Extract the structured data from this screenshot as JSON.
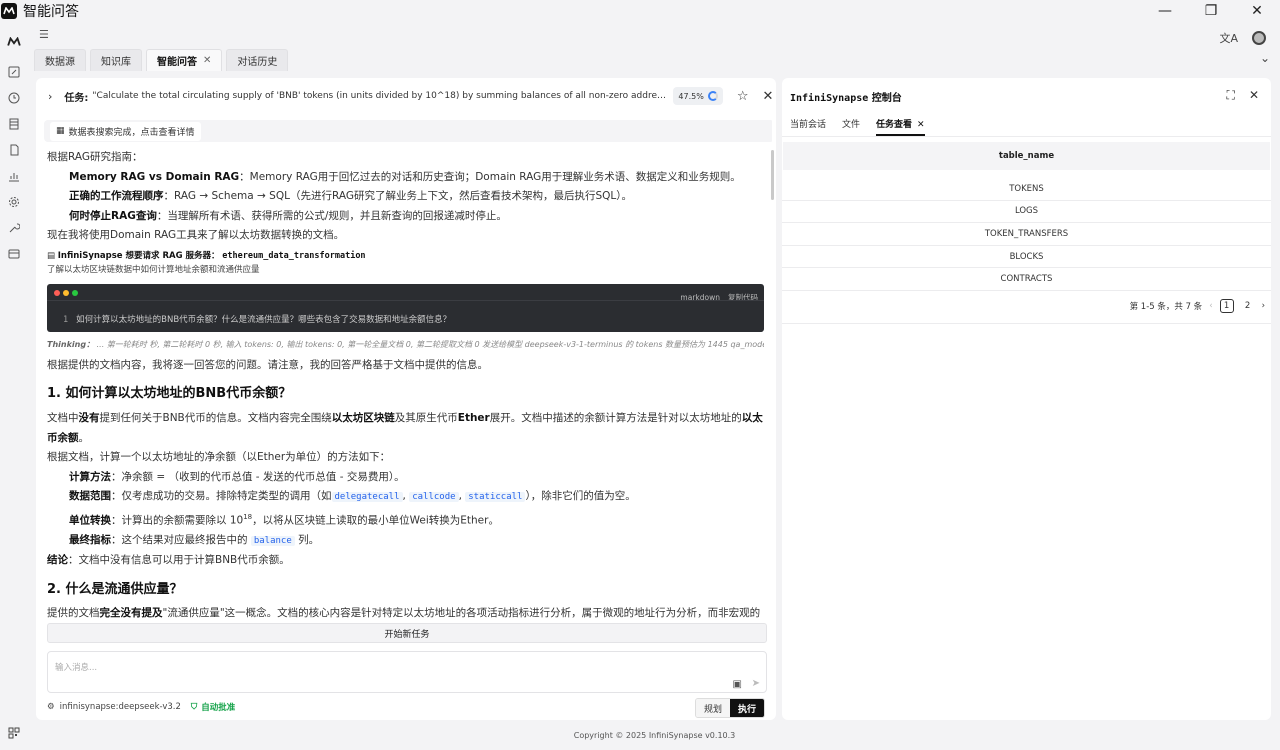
{
  "app": {
    "title": "智能问答"
  },
  "window_controls": {
    "minimize": "—",
    "maximize": "❐",
    "close": "✕"
  },
  "tabs": [
    {
      "label": "数据源"
    },
    {
      "label": "知识库"
    },
    {
      "label": "智能问答",
      "active": true,
      "closable": true
    },
    {
      "label": "对话历史"
    }
  ],
  "task": {
    "label": "任务:",
    "text": "\"Calculate the total circulating supply of 'BNB' tokens (in units divided by 10^18) by summing balances of all non-zero addresses, where each address's balance is calculated by subtracting all outgoing transfers and gas fees from all incoming transfers\"",
    "progress": "47.5%"
  },
  "search_banner": {
    "label": "数据表搜索完成，点击查看详情"
  },
  "content": {
    "p1": "根据RAG研究指南：",
    "b1_title": "Memory RAG vs Domain RAG",
    "b1_text": "：Memory RAG用于回忆过去的对话和历史查询；Domain RAG用于理解业务术语、数据定义和业务规则。",
    "b2_title": "正确的工作流程顺序",
    "b2_text": "：RAG → Schema → SQL（先进行RAG研究了解业务上下文，然后查看技术架构，最后执行SQL）。",
    "b3_title": "何时停止RAG查询",
    "b3_text": "：当理解所有术语、获得所需的公式/规则，并且新查询的回报递减时停止。",
    "p2": "现在我将使用Domain RAG工具来了解以太坊数据转换的文档。",
    "rag_req_title": "InfiniSynapse 想要请求 RAG 服务器：",
    "rag_req_server": "ethereum_data_transformation",
    "rag_req_sub": "了解以太坊区块链数据中如何计算地址余额和流通供应量",
    "code_lang": "markdown",
    "code_copy": "复制代码",
    "code_line_no": "1",
    "code_line": "如何计算以太坊地址的BNB代币余额？什么是流通供应量？哪些表包含了交易数据和地址余额信息？",
    "thinking_label": "Thinking：",
    "thinking_text": "... 第一轮耗时 秒, 第二轮耗时 0 秒, 输入 tokens: 0, 输出 tokens: 0, 第一轮全量文档 0, 第二轮提取文档 0 发送给模型 deepseek-v3-1-terminus 的 tokens 数量预估为 1445 qa_model_thinking",
    "p3": "根据提供的文档内容，我将逐一回答您的问题。请注意，我的回答严格基于文档中提供的信息。",
    "h1": "1. 如何计算以太坊地址的BNB代币余额？",
    "p4_a": "文档中",
    "p4_b": "没有",
    "p4_c": "提到任何关于BNB代币的信息。文档内容完全围绕",
    "p4_d": "以太坊区块链",
    "p4_e": "及其原生代币",
    "p4_f": "Ether",
    "p4_g": "展开。文档中描述的余额计算方法是针对以太坊地址的",
    "p4_h": "以太币余额",
    "p4_i": "。",
    "p5": "根据文档，计算一个以太坊地址的净余额（以Ether为单位）的方法如下：",
    "l1_t": "计算方法",
    "l1_x": "：净余额 = （收到的代币总值 - 发送的代币总值 - 交易费用）。",
    "l2_t": "数据范围",
    "l2_x": "：仅考虑成功的交易。排除特定类型的调用（如",
    "l2_c1": "delegatecall",
    "l2_c2": "callcode",
    "l2_c3": "staticcall",
    "l2_y": "），除非它们的值为空。",
    "l3_t": "单位转换",
    "l3_x": "：计算出的余额需要除以 10",
    "l3_sup": "18",
    "l3_y": "，以将从区块链上读取的最小单位Wei转换为Ether。",
    "l4_t": "最终指标",
    "l4_x": "：这个结果对应最终报告中的",
    "l4_c": "balance",
    "l4_y": "列。",
    "c_t": "结论",
    "c_x": "：文档中没有信息可以用于计算BNB代币余额。",
    "h2": "2. 什么是流通供应量？",
    "p6_a": "提供的文档",
    "p6_b": "完全没有提及",
    "p6_c": "\"流通供应量\"这一概念。文档的核心内容是针对特定以太坊地址的各项活动指标进行分析，属于微观的地址行为分析，而非宏观的代币经济学概念（如总供应量、流通供应量等）。"
  },
  "new_task_button": "开始新任务",
  "input": {
    "placeholder": "输入消息..."
  },
  "model": {
    "name": "infinisynapse:deepseek-v3.2"
  },
  "auto_approve": "自动批准",
  "mode": {
    "plan": "规划",
    "execute": "执行"
  },
  "console": {
    "title_a": "InfiniSynapse",
    "title_b": " 控制台",
    "tabs": [
      {
        "label": "当前会话"
      },
      {
        "label": "文件"
      },
      {
        "label": "任务查看",
        "active": true
      }
    ],
    "table_header": "table_name",
    "rows": [
      "TOKENS",
      "LOGS",
      "TOKEN_TRANSFERS",
      "BLOCKS",
      "CONTRACTS"
    ],
    "pager": {
      "summary": "第 1-5 条，共 7 条",
      "pages": [
        "1",
        "2"
      ],
      "current": 1
    }
  },
  "footer": "Copyright © 2025 InfiniSynapse v0.10.3"
}
